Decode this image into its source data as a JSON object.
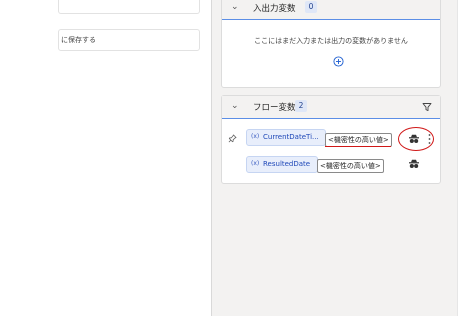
{
  "left_panel": {
    "save_text": "に保存する"
  },
  "io_section": {
    "title": "入出力変数",
    "count": "0",
    "empty_message": "ここにはまだ入力または出力の変数がありません",
    "add_icon": "plus-circle-icon"
  },
  "flow_section": {
    "title": "フロー変数",
    "count": "2",
    "filter_icon": "filter-icon",
    "variables": [
      {
        "name": "CurrentDateTi...",
        "value": "<機密性の高い値>",
        "pinned": true,
        "icon": "spy-icon"
      },
      {
        "name": "ResultedDate",
        "value": "<機密性の高い値>",
        "pinned": false,
        "icon": "spy-icon"
      }
    ]
  },
  "colors": {
    "accent": "#5b8ee6",
    "annotation_red": "#d01818",
    "chip_text": "#1f48b8",
    "pane_background": "#f3f2f1"
  }
}
